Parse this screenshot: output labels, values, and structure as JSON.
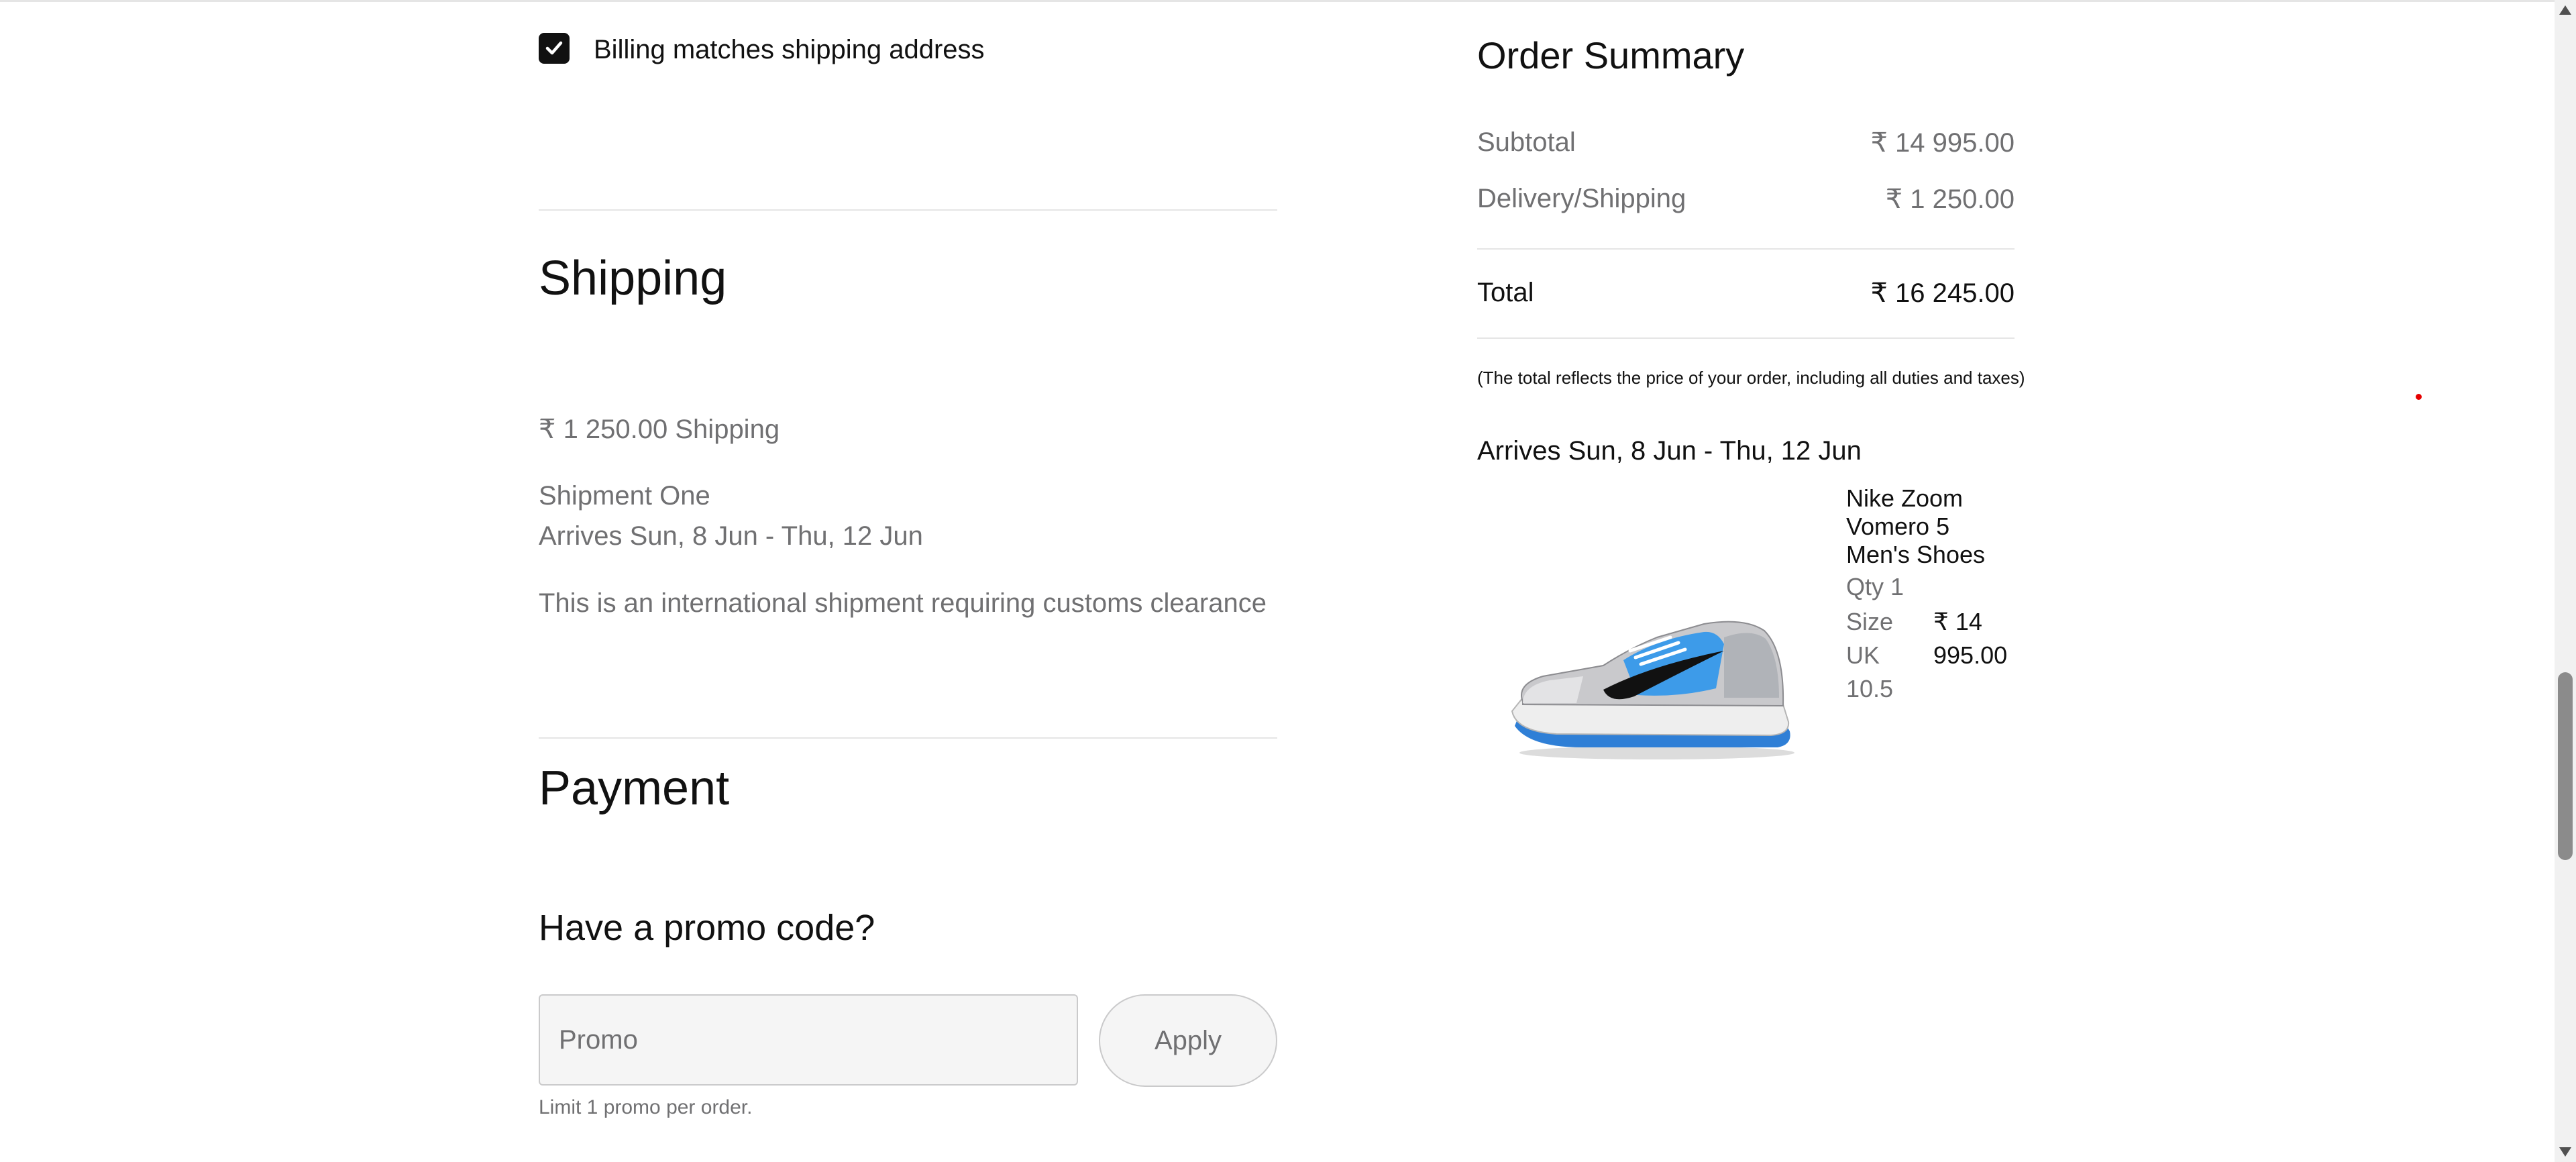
{
  "billing": {
    "checkbox_checked": true,
    "checkbox_label": "Billing matches shipping address"
  },
  "shipping": {
    "title": "Shipping",
    "cost_line": "₹ 1 250.00 Shipping",
    "shipment_label": "Shipment One",
    "arrives": "Arrives Sun, 8 Jun - Thu, 12 Jun",
    "international_note": "This is an international shipment requiring customs clearance"
  },
  "payment": {
    "title": "Payment",
    "promo_heading": "Have a promo code?",
    "promo_placeholder": "Promo",
    "promo_value": "",
    "apply_label": "Apply",
    "limit_note": "Limit 1 promo per order."
  },
  "order_summary": {
    "title": "Order Summary",
    "subtotal_label": "Subtotal",
    "subtotal_value": "₹ 14 995.00",
    "delivery_label": "Delivery/Shipping",
    "delivery_value": "₹ 1 250.00",
    "total_label": "Total",
    "total_value": "₹ 16 245.00",
    "note": "(The total reflects the price of your order, including all duties and taxes)",
    "arrives": "Arrives Sun, 8 Jun - Thu, 12 Jun",
    "product": {
      "name": "Nike Zoom Vomero 5 Men's Shoes",
      "qty": "Qty 1",
      "size": "Size UK 10.5",
      "price": "₹ 14 995.00",
      "image": "sneaker-image"
    }
  },
  "colors": {
    "text_primary": "#111111",
    "text_muted": "#707072",
    "divider": "#e5e5e5",
    "input_bg": "#f5f5f5",
    "accent_blue": "#3d9be9"
  }
}
